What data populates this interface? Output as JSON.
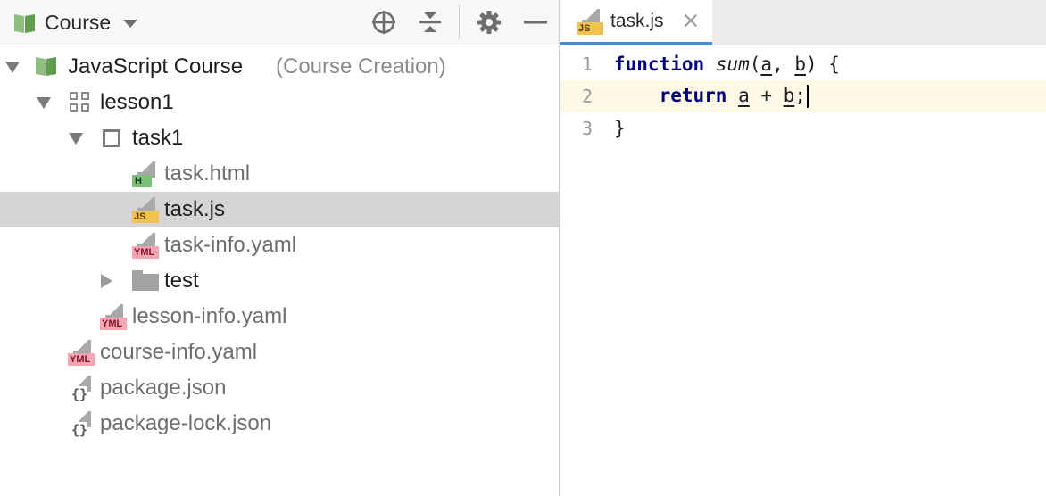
{
  "project_panel": {
    "title": "Course",
    "tree": [
      {
        "label": "JavaScript Course",
        "suffix": "(Course Creation)"
      },
      {
        "label": "lesson1"
      },
      {
        "label": "task1"
      },
      {
        "label": "task.html",
        "badge": "H"
      },
      {
        "label": "task.js",
        "badge": "JS"
      },
      {
        "label": "task-info.yaml",
        "badge": "YML"
      },
      {
        "label": "test"
      },
      {
        "label": "lesson-info.yaml",
        "badge": "YML"
      },
      {
        "label": "course-info.yaml",
        "badge": "YML"
      },
      {
        "label": "package.json",
        "badge": "{}"
      },
      {
        "label": "package-lock.json",
        "badge": "{}"
      }
    ]
  },
  "editor": {
    "tab": {
      "label": "task.js",
      "badge": "JS"
    },
    "line_numbers": [
      "1",
      "2",
      "3"
    ],
    "code": {
      "l1": {
        "kw": "function",
        "fn": "sum",
        "p1": "(",
        "a": "a",
        "comma": ", ",
        "b": "b",
        "rest": ") {"
      },
      "l2": {
        "indent": "    ",
        "kw": "return",
        "sp": " ",
        "a": "a",
        "op": " + ",
        "b": "b",
        "end": ";"
      },
      "l3": {
        "text": "}"
      }
    }
  },
  "colors": {
    "selection": "#d5d5d5",
    "tab_underline": "#4a88c7",
    "keyword": "#00007f",
    "current_line": "#fdf9e6"
  }
}
